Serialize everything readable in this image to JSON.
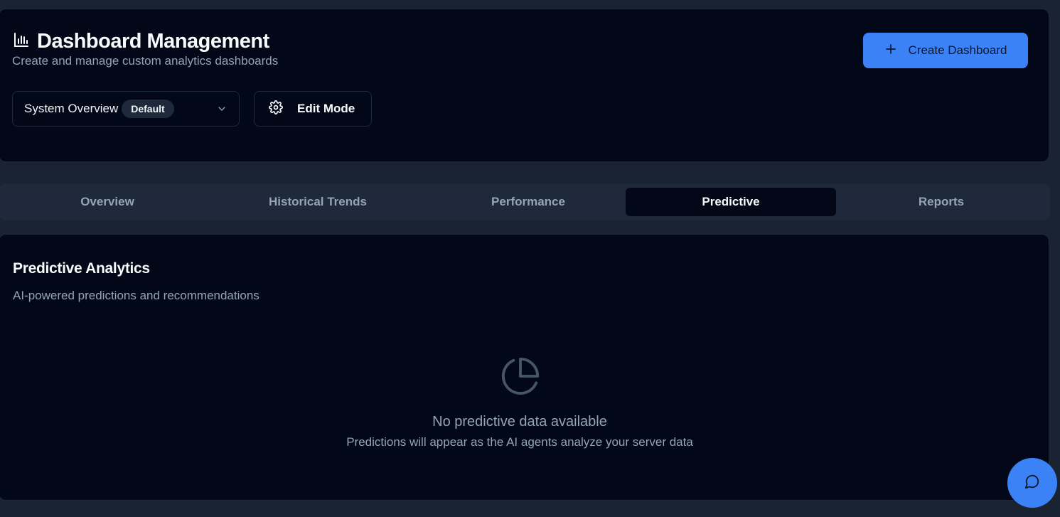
{
  "header": {
    "title": "Dashboard Management",
    "subtitle": "Create and manage custom analytics dashboards",
    "title_icon": "bar-chart-icon",
    "create_button": {
      "label": "Create Dashboard",
      "icon": "plus-icon"
    },
    "dashboard_select": {
      "value": "System Overview",
      "badge": "Default",
      "icon": "chevron-down-icon"
    },
    "edit_button": {
      "label": "Edit Mode",
      "icon": "gear-icon"
    }
  },
  "tabs": [
    {
      "label": "Overview",
      "active": false
    },
    {
      "label": "Historical Trends",
      "active": false
    },
    {
      "label": "Performance",
      "active": false
    },
    {
      "label": "Predictive",
      "active": true
    },
    {
      "label": "Reports",
      "active": false
    }
  ],
  "panel": {
    "title": "Predictive Analytics",
    "subtitle": "AI-powered predictions and recommendations",
    "empty_icon": "pie-chart-icon",
    "empty_title": "No predictive data available",
    "empty_text": "Predictions will appear as the AI agents analyze your server data"
  },
  "chat_button": {
    "icon": "chat-bubble-icon"
  },
  "colors": {
    "background": "#1a2332",
    "card": "#020817",
    "border": "#1e293b",
    "accent": "#3b82f6",
    "muted_text": "#94a3b8"
  }
}
